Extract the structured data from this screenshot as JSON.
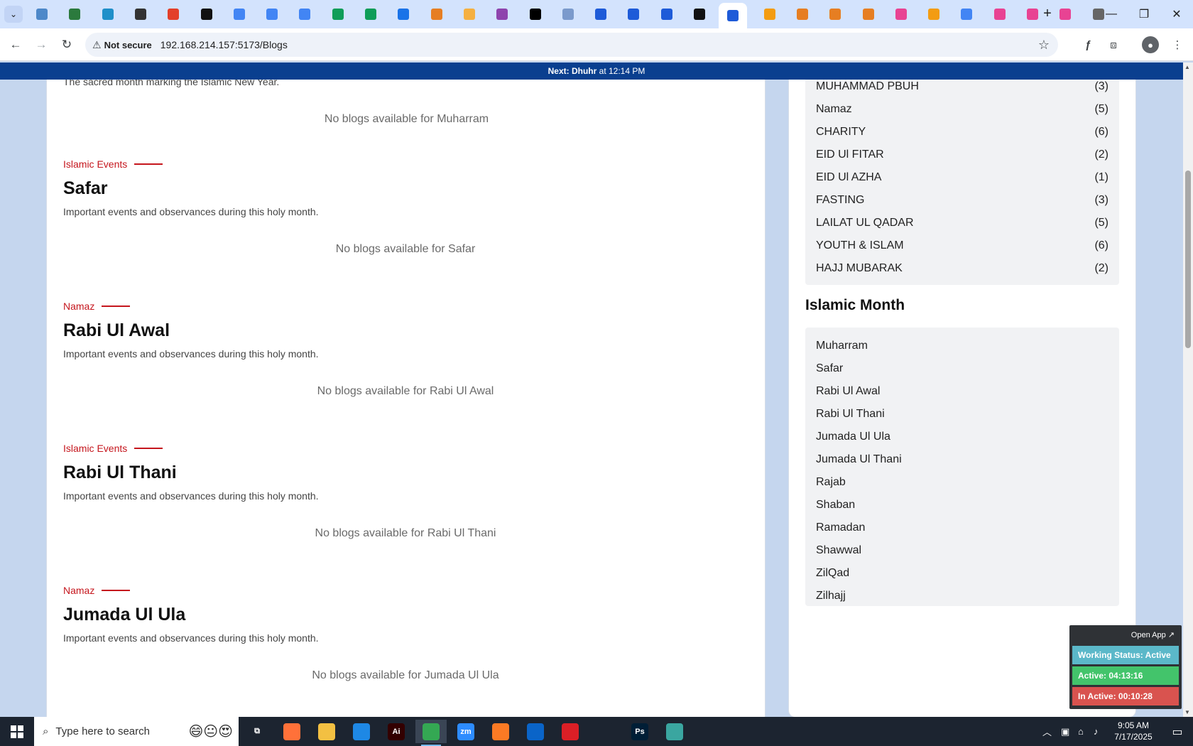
{
  "browser": {
    "not_secure": "Not secure",
    "url": "192.168.214.157:5173/Blogs",
    "tab_colors": [
      "#4d88c9",
      "#2b7a3d",
      "#1f8fc9",
      "#333333",
      "#e33f2a",
      "#111111",
      "#4285f4",
      "#4285f4",
      "#4285f4",
      "#0f9d58",
      "#0f9d58",
      "#1a73e8",
      "#e67e22",
      "#f5b041",
      "#8e44ad",
      "#000000",
      "#7b9acc",
      "#1e5bd8",
      "#1e5bd8",
      "#1e5bd8",
      "#111111",
      "#1e5bd8",
      "#f39c12",
      "#e67e22",
      "#e67e22",
      "#e67e22",
      "#e84393",
      "#f39c12",
      "#4285f4",
      "#e84393",
      "#e84393",
      "#e84393",
      "#666666"
    ],
    "new_tab": "+"
  },
  "banner": {
    "prefix": "Next: ",
    "prayer": "Dhuhr",
    "suffix": " at 12:14 PM"
  },
  "first_section": {
    "description": "The sacred month marking the Islamic New Year.",
    "empty": "No blogs available for Muharram"
  },
  "sections": [
    {
      "tag": "Islamic Events",
      "title": "Safar",
      "description": "Important events and observances during this holy month.",
      "empty": "No blogs available for Safar"
    },
    {
      "tag": "Namaz",
      "title": "Rabi Ul Awal",
      "description": "Important events and observances during this holy month.",
      "empty": "No blogs available for Rabi Ul Awal"
    },
    {
      "tag": "Islamic Events",
      "title": "Rabi Ul Thani",
      "description": "Important events and observances during this holy month.",
      "empty": "No blogs available for Rabi Ul Thani"
    },
    {
      "tag": "Namaz",
      "title": "Jumada Ul Ula",
      "description": "Important events and observances during this holy month.",
      "empty": "No blogs available for Jumada Ul Ula"
    }
  ],
  "categories": [
    {
      "name": "MUHAMMAD PBUH",
      "count": "(3)"
    },
    {
      "name": "Namaz",
      "count": "(5)"
    },
    {
      "name": "CHARITY",
      "count": "(6)"
    },
    {
      "name": "EID Ul FITAR",
      "count": "(2)"
    },
    {
      "name": "EID Ul AZHA",
      "count": "(1)"
    },
    {
      "name": "FASTING",
      "count": "(3)"
    },
    {
      "name": "LAILAT UL QADAR",
      "count": "(5)"
    },
    {
      "name": "YOUTH & ISLAM",
      "count": "(6)"
    },
    {
      "name": "HAJJ MUBARAK",
      "count": "(2)"
    }
  ],
  "islamic_month": {
    "heading": "Islamic Month",
    "months": [
      "Muharram",
      "Safar",
      "Rabi Ul Awal",
      "Rabi Ul Thani",
      "Jumada Ul Ula",
      "Jumada Ul Thani",
      "Rajab",
      "Shaban",
      "Ramadan",
      "Shawwal",
      "ZilQad",
      "Zilhajj"
    ]
  },
  "widget": {
    "open_app": "Open App ↗",
    "working_status": "Working Status: Active",
    "active": "Active: 04:13:16",
    "inactive": "In Active: 00:10:28",
    "colors": {
      "status": "#5bb8c9",
      "active": "#43c46b",
      "inactive": "#d9534f"
    }
  },
  "taskbar": {
    "search_placeholder": "Type here to search",
    "time": "9:05 AM",
    "date": "7/17/2025",
    "apps": [
      {
        "name": "task-view",
        "label": "⧉",
        "color": "#1c2430"
      },
      {
        "name": "firefox",
        "label": "",
        "color": "#ff7139"
      },
      {
        "name": "file-explorer",
        "label": "",
        "color": "#f3c042"
      },
      {
        "name": "vscode",
        "label": "",
        "color": "#1e88e5"
      },
      {
        "name": "illustrator",
        "label": "Ai",
        "color": "#330000"
      },
      {
        "name": "chrome",
        "label": "",
        "color": "#34a853"
      },
      {
        "name": "zoom",
        "label": "zm",
        "color": "#2d8cff"
      },
      {
        "name": "xampp",
        "label": "",
        "color": "#fb7a24"
      },
      {
        "name": "outlook",
        "label": "",
        "color": "#0a64c8"
      },
      {
        "name": "creative-cloud",
        "label": "",
        "color": "#da1f26"
      },
      {
        "name": "pen-tool",
        "label": "",
        "color": "#1c2430"
      },
      {
        "name": "photoshop",
        "label": "Ps",
        "color": "#001e36"
      },
      {
        "name": "app-diamond",
        "label": "",
        "color": "#3aa6a0"
      }
    ]
  }
}
